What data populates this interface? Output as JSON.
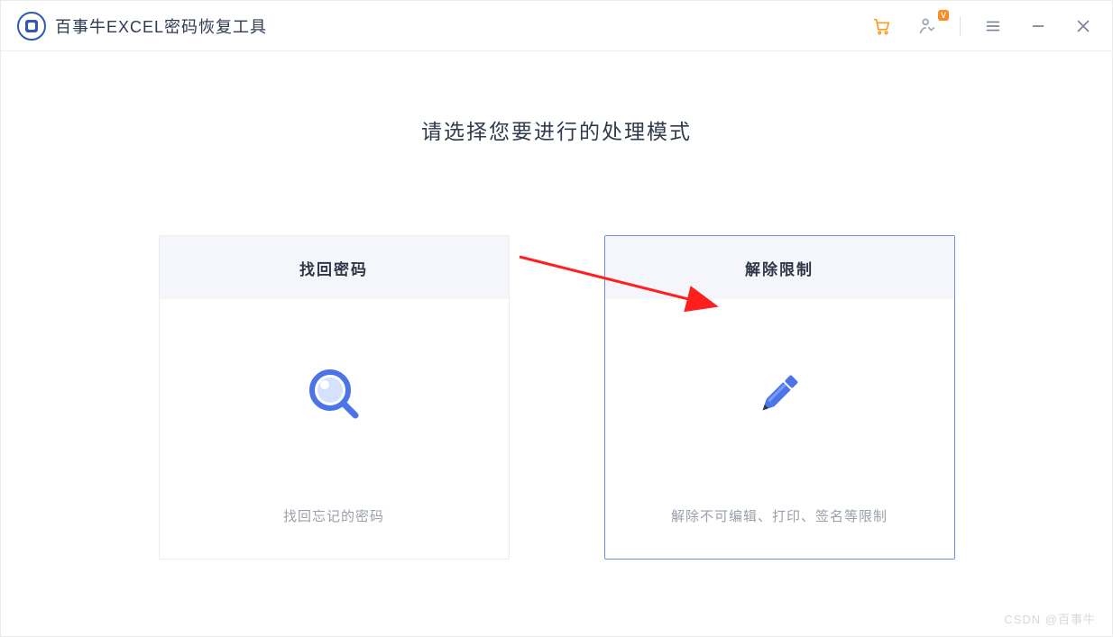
{
  "app": {
    "title": "百事牛EXCEL密码恢复工具"
  },
  "titlebar": {
    "vip_badge": "V"
  },
  "main": {
    "heading": "请选择您要进行的处理模式",
    "cards": [
      {
        "title": "找回密码",
        "desc": "找回忘记的密码",
        "selected": false,
        "icon": "search"
      },
      {
        "title": "解除限制",
        "desc": "解除不可编辑、打印、签名等限制",
        "selected": true,
        "icon": "pencil"
      }
    ]
  },
  "watermark": "CSDN @百事牛"
}
